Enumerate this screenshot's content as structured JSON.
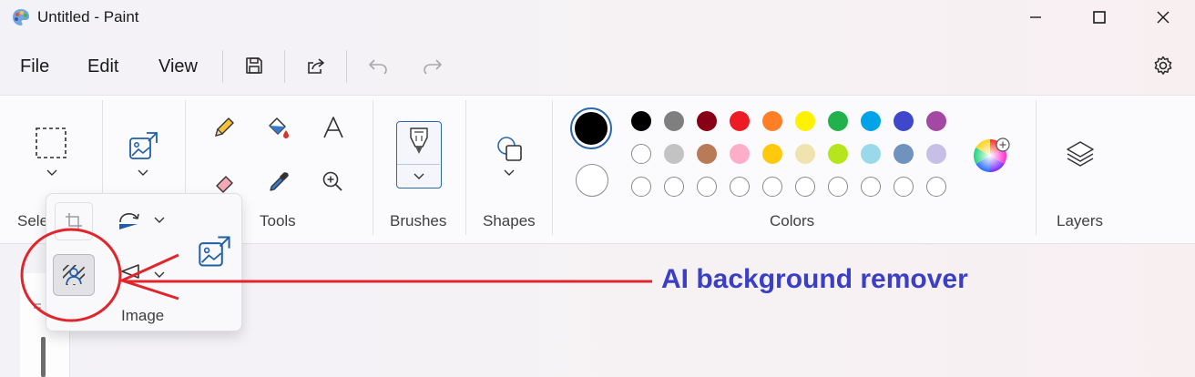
{
  "window": {
    "title": "Untitled - Paint",
    "controls": [
      "minimize-icon",
      "maximize-icon",
      "close-icon"
    ]
  },
  "menu": {
    "file": "File",
    "edit": "Edit",
    "view": "View"
  },
  "quick_access": [
    "save-icon",
    "share-icon",
    "undo-icon",
    "redo-icon"
  ],
  "ribbon": {
    "groups": {
      "selection": "Sele",
      "tools": "Tools",
      "brushes": "Brushes",
      "shapes": "Shapes",
      "colors": "Colors",
      "layers": "Layers"
    }
  },
  "colors": {
    "primary": "#000000",
    "secondary": "#ffffff",
    "row1": [
      "#000000",
      "#7f7f7f",
      "#880015",
      "#ed1c24",
      "#ff7f27",
      "#fff200",
      "#22b14c",
      "#00a2e8",
      "#3f48cc",
      "#a349a4"
    ],
    "row2": [
      "#ffffff",
      "#c3c3c3",
      "#b97a57",
      "#ffaec9",
      "#ffc90e",
      "#efe4b0",
      "#b5e61d",
      "#99d9ea",
      "#7092be",
      "#c8bfe7"
    ],
    "row3_custom_empty": 10
  },
  "image_flyout": {
    "label": "Image"
  },
  "annotation": {
    "text": "AI background remover",
    "color": "#3b3fc6",
    "arrow_color": "#e0262c"
  }
}
